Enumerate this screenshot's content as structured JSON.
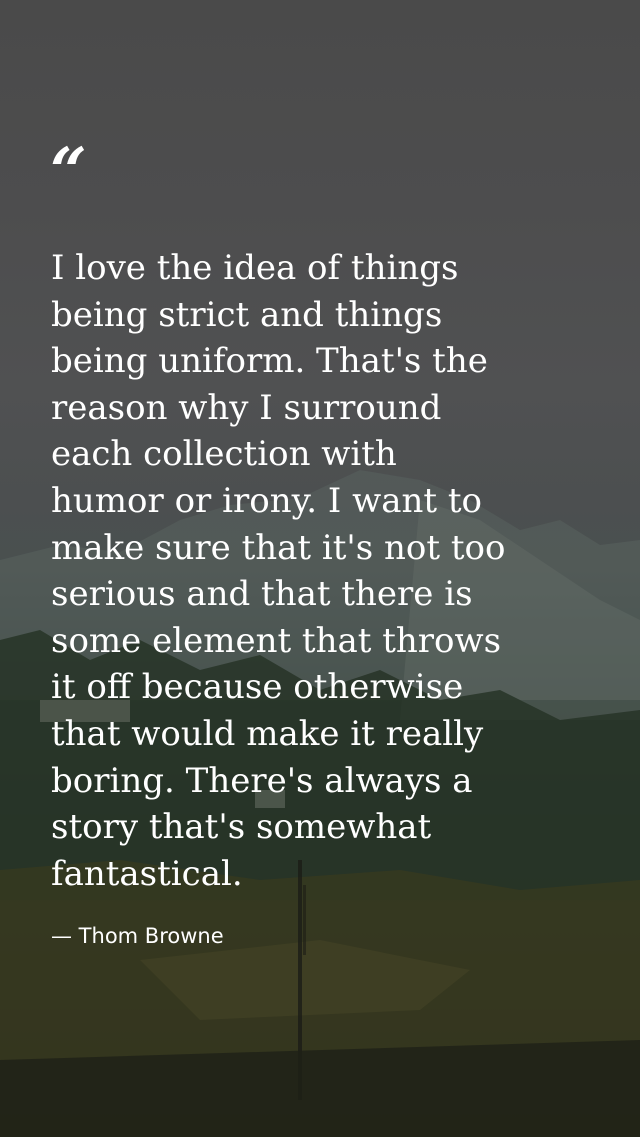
{
  "quote": {
    "open_mark": "“",
    "text": "I love the idea of things\nbeing strict and things\nbeing uniform. That's the\nreason why I surround\neach collection with\nhumor or irony. I want to\nmake sure that it's not too\nserious and that there is\nsome element that throws\nit off because otherwise\nthat would make it really\nboring. There's always a\nstory that's somewhat\nfantastical.",
    "attribution": "— Thom Browne"
  },
  "colors": {
    "text": "#ffffff",
    "overlay": "#4a4a4a"
  }
}
